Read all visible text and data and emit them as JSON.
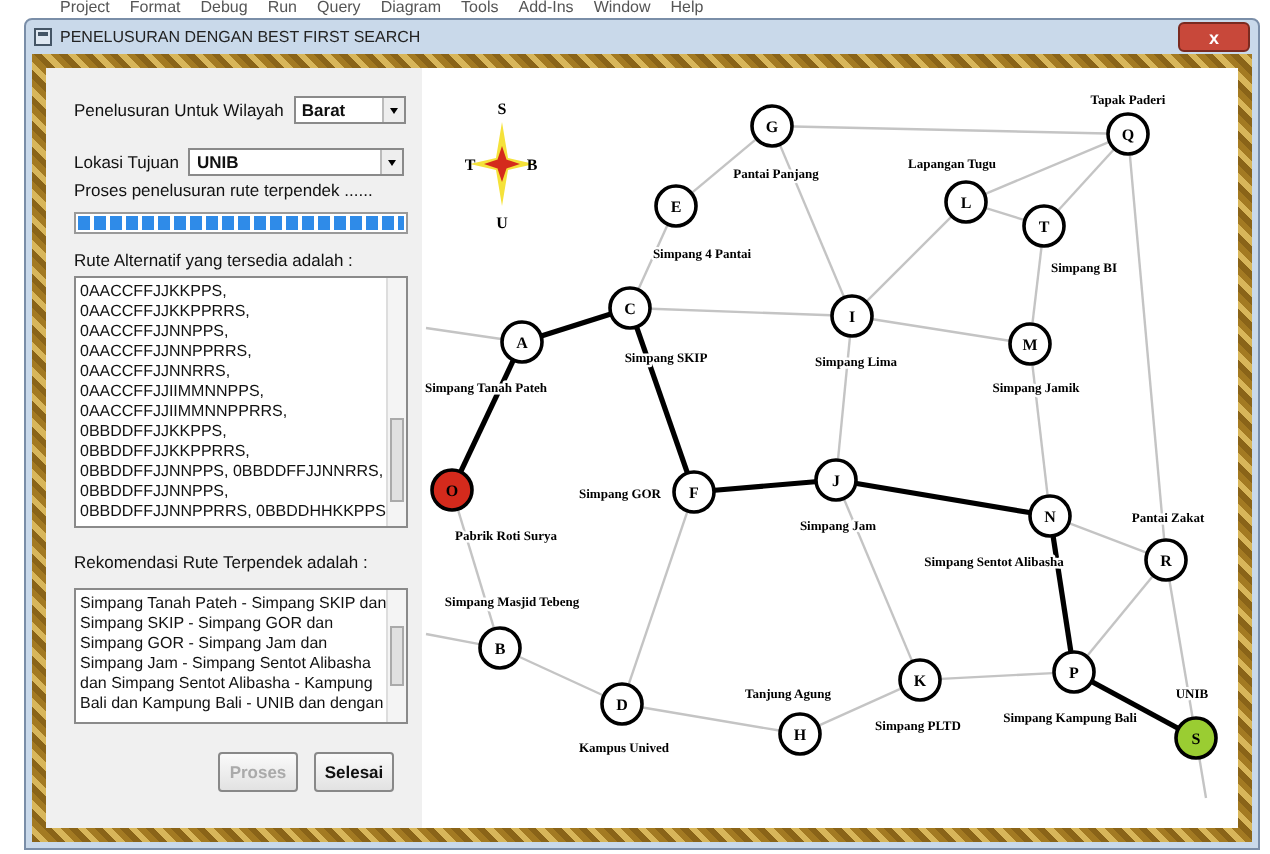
{
  "background_menu": [
    "Project",
    "Format",
    "Debug",
    "Run",
    "Query",
    "Diagram",
    "Tools",
    "Add-Ins",
    "Window",
    "Help"
  ],
  "window": {
    "title": "PENELUSURAN DENGAN BEST FIRST SEARCH",
    "close": "x"
  },
  "region": {
    "label": "Penelusuran Untuk Wilayah",
    "value": "Barat"
  },
  "destination": {
    "label": "Lokasi Tujuan",
    "value": "UNIB"
  },
  "progress": {
    "label": "Proses penelusuran rute terpendek ......",
    "level": 1
  },
  "alternatives": {
    "label": "Rute Alternatif yang tersedia adalah :",
    "lines": [
      "0AACCFFJJKKPPS,",
      "0AACCFFJJKKPPRRS,",
      "0AACCFFJJNNPPS,",
      "0AACCFFJJNNPPRRS,",
      "0AACCFFJJNNRRS,",
      "0AACCFFJJIIMMNNPPS,",
      "0AACCFFJJIIMMNNPPRRS,",
      "0BBDDFFJJKKPPS,",
      "0BBDDFFJJKKPPRRS,",
      "0BBDDFFJJNNPPS, 0BBDDFFJJNNRRS,",
      "0BBDDFFJJNNPPS,",
      "0BBDDFFJJNNPPRRS, 0BBDDHHKKPPS"
    ]
  },
  "recommendation": {
    "label": "Rekomendasi Rute Terpendek adalah :",
    "lines": [
      "Simpang Tanah Pateh - Simpang SKIP dan",
      "Simpang SKIP - Simpang GOR dan",
      "Simpang GOR - Simpang Jam dan",
      "Simpang Jam - Simpang Sentot Alibasha",
      "dan Simpang Sentot Alibasha - Kampung",
      "Bali dan Kampung Bali - UNIB dan  dengan"
    ]
  },
  "buttons": [
    {
      "label": "Proses",
      "disabled": true
    },
    {
      "label": "Selesai",
      "disabled": false
    }
  ],
  "compass": {
    "north": "S",
    "west": "T",
    "east": "B",
    "south": "U"
  },
  "map": {
    "nodes": [
      {
        "letter": "G",
        "label": "Pantai Panjang",
        "color": "#ffffff"
      },
      {
        "letter": "Q",
        "label": "Tapak Paderi",
        "color": "#ffffff"
      },
      {
        "letter": "E",
        "label": "Simpang 4 Pantai",
        "color": "#ffffff"
      },
      {
        "letter": "L",
        "label": "Lapangan Tugu",
        "color": "#ffffff"
      },
      {
        "letter": "T",
        "label": "Simpang BI",
        "color": "#ffffff"
      },
      {
        "letter": "C",
        "label": "Simpang SKIP",
        "color": "#ffffff"
      },
      {
        "letter": "I",
        "label": "Simpang Lima",
        "color": "#ffffff"
      },
      {
        "letter": "A",
        "label": "Simpang Tanah Pateh",
        "color": "#ffffff"
      },
      {
        "letter": "M",
        "label": "Simpang Jamik",
        "color": "#ffffff"
      },
      {
        "letter": "O",
        "label": "Pabrik Roti Surya",
        "color": "#d42a1c"
      },
      {
        "letter": "F",
        "label": "Simpang GOR",
        "color": "#ffffff"
      },
      {
        "letter": "J",
        "label": "Simpang Jam",
        "color": "#ffffff"
      },
      {
        "letter": "N",
        "label": "Simpang Sentot Alibasha",
        "color": "#ffffff"
      },
      {
        "letter": "R",
        "label": "Pantai Zakat",
        "color": "#ffffff"
      },
      {
        "letter": "B",
        "label": "Simpang Masjid Tebeng",
        "color": "#ffffff"
      },
      {
        "letter": "K",
        "label": "Simpang PLTD",
        "color": "#ffffff"
      },
      {
        "letter": "P",
        "label": "Simpang Kampung Bali",
        "color": "#ffffff"
      },
      {
        "letter": "D",
        "label": "Kampus Unived",
        "color": "#ffffff"
      },
      {
        "letter": "H",
        "label": "Tanjung Agung",
        "color": "#ffffff"
      },
      {
        "letter": "S",
        "label": "UNIB",
        "color": "#9acd32"
      }
    ],
    "edges": [
      {
        "on_route": false
      },
      {
        "on_route": false
      },
      {
        "on_route": false
      },
      {
        "on_route": false
      },
      {
        "on_route": false
      },
      {
        "on_route": false
      },
      {
        "on_route": false
      },
      {
        "on_route": false
      },
      {
        "on_route": false
      },
      {
        "on_route": false
      },
      {
        "on_route": false
      },
      {
        "on_route": false
      },
      {
        "on_route": false
      },
      {
        "on_route": false
      },
      {
        "on_route": false
      },
      {
        "on_route": false
      },
      {
        "on_route": false
      },
      {
        "on_route": false
      },
      {
        "on_route": false
      },
      {
        "on_route": false
      },
      {
        "on_route": false
      },
      {
        "on_route": false
      },
      {
        "on_route": false
      },
      {
        "on_route": false
      },
      {
        "on_route": false
      },
      {
        "on_route": false
      },
      {
        "on_route": false
      },
      {
        "on_route": true
      },
      {
        "on_route": true
      },
      {
        "on_route": true
      },
      {
        "on_route": true
      },
      {
        "on_route": true
      },
      {
        "on_route": true
      },
      {
        "on_route": true
      }
    ]
  }
}
